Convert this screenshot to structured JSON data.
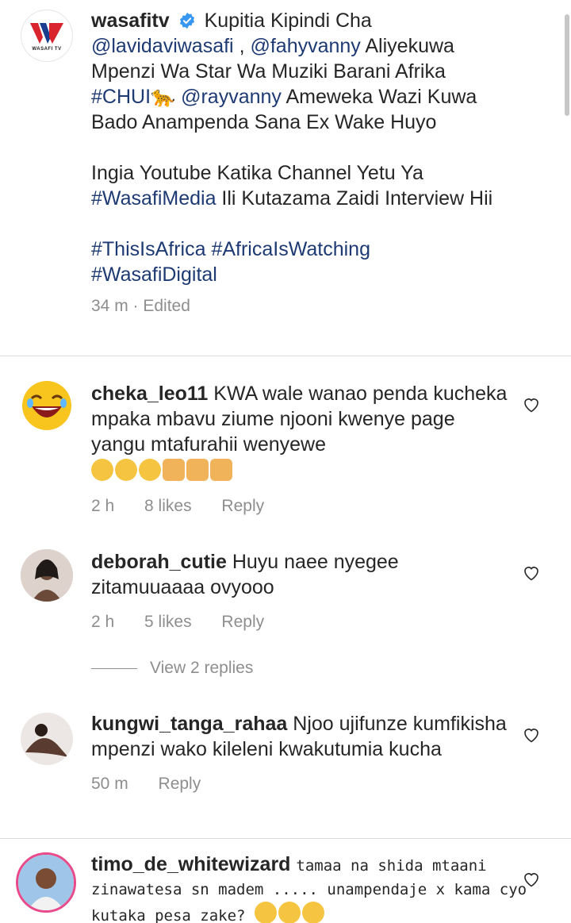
{
  "post": {
    "username": "wasafitv",
    "segments": [
      {
        "t": "Kupitia Kipindi Cha "
      },
      {
        "t": "@lavidaviwasafi",
        "link": true
      },
      {
        "t": " , "
      },
      {
        "t": "@fahyvanny",
        "link": true
      },
      {
        "t": " Aliyekuwa Mpenzi Wa Star Wa Muziki Barani Afrika "
      },
      {
        "t": "#CHUI🐆",
        "link": true
      },
      {
        "t": " "
      },
      {
        "t": "@rayvanny",
        "link": true
      },
      {
        "t": " Ameweka Wazi Kuwa Bado Anampenda Sana Ex Wake Huyo"
      }
    ],
    "paragraph2": [
      {
        "t": "Ingia Youtube Katika Channel Yetu Ya "
      },
      {
        "t": "#WasafiMedia",
        "link": true
      },
      {
        "t": " Ili Kutazama Zaidi Interview Hii"
      }
    ],
    "paragraph3": [
      {
        "t": "#ThisIsAfrica",
        "link": true
      },
      {
        "t": " "
      },
      {
        "t": "#AfricaIsWatching",
        "link": true
      },
      {
        "t": " "
      },
      {
        "t": "#WasafiDigital",
        "link": true
      }
    ],
    "time": "34 m",
    "edited": "Edited",
    "logo_text": "WASAFI TV",
    "colors": {
      "logo_red": "#d9232d",
      "logo_blue": "#1b3d8f",
      "verified": "#3897f0",
      "link": "#1e3a73"
    }
  },
  "comments": [
    {
      "username": "cheka_leo11",
      "text": "KWA wale wanao penda kucheka mpaka mbavu ziume njooni kwenye page yangu mtafurahii wenyewe",
      "time": "2 h",
      "likes": "8 likes",
      "reply": "Reply"
    },
    {
      "username": "deborah_cutie",
      "text": "Huyu naee nyegee zitamuuaaaa ovyooo",
      "time": "2 h",
      "likes": "5 likes",
      "reply": "Reply"
    },
    {
      "username": "kungwi_tanga_rahaa",
      "text": "Njoo ujifunze kumfikisha mpenzi wako kileleni kwakutumia kucha",
      "time": "50 m",
      "reply": "Reply"
    },
    {
      "username": "timo_de_whitewizard",
      "text_a": "tamaa na shida mtaani",
      "text_b": "zinawatesa sn madem ..... unampendaje x kama cyo",
      "text_c": "kutaka pesa zake?"
    }
  ],
  "view_replies": "View 2 replies"
}
